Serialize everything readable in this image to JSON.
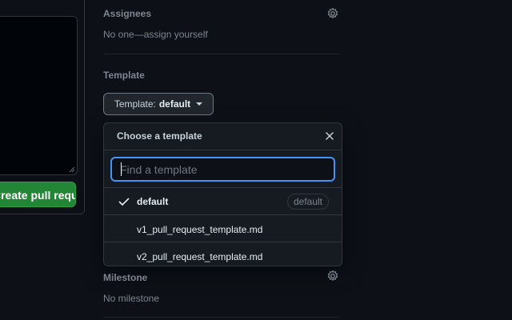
{
  "left": {
    "submit_label": "Create pull request"
  },
  "assignees": {
    "title": "Assignees",
    "text": "No one—assign yourself",
    "icon": "gear-icon"
  },
  "template": {
    "title": "Template",
    "button_prefix": "Template:",
    "button_value": "default"
  },
  "popover": {
    "title": "Choose a template",
    "filter_placeholder": "Find a template",
    "filter_value": "",
    "items": [
      {
        "label": "default",
        "selected": true,
        "badge": "default"
      },
      {
        "label": "v1_pull_request_template.md",
        "selected": false
      },
      {
        "label": "v2_pull_request_template.md",
        "selected": false
      }
    ]
  },
  "milestone": {
    "title": "Milestone",
    "text": "No milestone",
    "icon": "gear-icon"
  },
  "colors": {
    "background": "#0d1117",
    "accent": "#4493f8",
    "primary_button": "#238636",
    "muted_text": "#7d8590"
  }
}
